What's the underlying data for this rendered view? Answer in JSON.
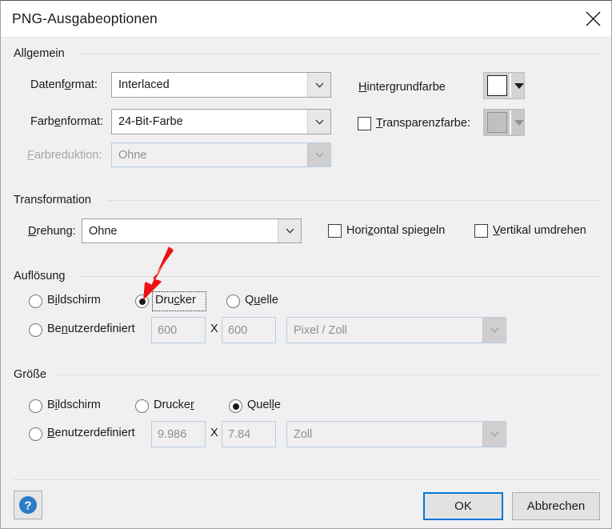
{
  "window": {
    "title": "PNG-Ausgabeoptionen",
    "close_icon": "close-icon"
  },
  "groups": {
    "allgemein": {
      "title": "Allgemein",
      "fields": [
        {
          "label_pre": "Datenf",
          "label_mnemonic": "o",
          "label_post": "rmat:",
          "value": "Interlaced",
          "disabled": false
        },
        {
          "label_pre": "Farb",
          "label_mnemonic": "e",
          "label_post": "nformat:",
          "value": "24-Bit-Farbe",
          "disabled": false
        },
        {
          "label_pre": "",
          "label_mnemonic": "F",
          "label_post": "arbreduktion:",
          "value": "Ohne",
          "disabled": true
        }
      ],
      "background_color": {
        "label_pre": "",
        "label_mnemonic": "H",
        "label_post": "intergrundfarbe",
        "swatch_color": "#ffffff"
      },
      "transparency_color": {
        "label_pre": "",
        "label_mnemonic": "T",
        "label_post": "ransparenzfarbe:",
        "checked": false,
        "disabled": true,
        "swatch_color": "#c0c0c0"
      }
    },
    "transformation": {
      "title": "Transformation",
      "rotation": {
        "label_pre": "",
        "label_mnemonic": "D",
        "label_post": "rehung:",
        "value": "Ohne"
      },
      "checkboxes": [
        {
          "label_pre": "Hori",
          "label_mnemonic": "z",
          "label_post": "ontal spiegeln",
          "checked": false
        },
        {
          "label_pre": "",
          "label_mnemonic": "V",
          "label_post": "ertikal umdrehen",
          "checked": false
        }
      ]
    },
    "aufloesung": {
      "title": "Auflösung",
      "radios": [
        {
          "label_pre": "B",
          "label_mnemonic": "i",
          "label_post": "ldschirm",
          "checked": false,
          "focused": false
        },
        {
          "label_pre": "Dru",
          "label_mnemonic": "c",
          "label_post": "ker",
          "checked": true,
          "focused": true
        },
        {
          "label_pre": "Q",
          "label_mnemonic": "u",
          "label_post": "elle",
          "checked": false,
          "focused": false
        },
        {
          "label_pre": "Be",
          "label_mnemonic": "n",
          "label_post": "utzerdefiniert",
          "checked": false,
          "focused": false
        }
      ],
      "width_value": "600",
      "separator": "X",
      "height_value": "600",
      "unit_value": "Pixel / Zoll",
      "inputs_disabled": true
    },
    "groesse": {
      "title": "Größe",
      "radios": [
        {
          "label_pre": "B",
          "label_mnemonic": "i",
          "label_post": "ldschirm",
          "checked": false
        },
        {
          "label_pre": "Drucke",
          "label_mnemonic": "r",
          "label_post": "",
          "checked": false
        },
        {
          "label_pre": "Quel",
          "label_mnemonic": "l",
          "label_post": "e",
          "checked": true
        },
        {
          "label_pre": "",
          "label_mnemonic": "B",
          "label_post": "enutzerdefiniert",
          "checked": false
        }
      ],
      "width_value": "9.986",
      "separator": "X",
      "height_value": "7.84",
      "unit_value": "Zoll",
      "inputs_disabled": true
    }
  },
  "footer": {
    "help_icon": "help-icon",
    "ok_label": "OK",
    "cancel_label": "Abbrechen"
  },
  "annotation": {
    "arrow_color": "#ee1111",
    "points_at": "Drucker"
  }
}
